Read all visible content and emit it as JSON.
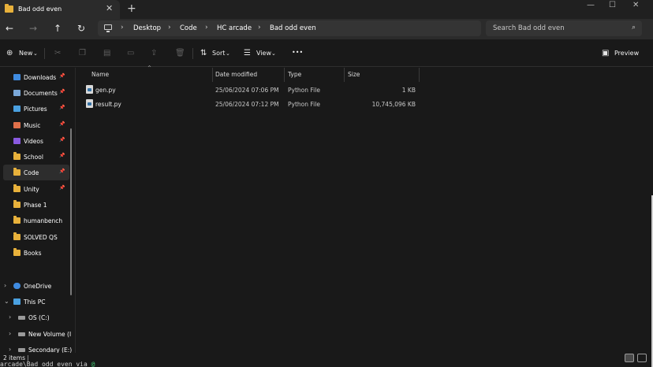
{
  "window": {
    "tab_title": "Bad odd even",
    "tab_close": "✕",
    "new_tab": "+",
    "minimize": "—",
    "maximize": "☐",
    "close": "✕"
  },
  "nav": {
    "back": "←",
    "forward": "→",
    "up": "↑",
    "refresh": "↻"
  },
  "breadcrumb": [
    "Desktop",
    "Code",
    "HC arcade",
    "Bad odd even"
  ],
  "search": {
    "placeholder": "Search Bad odd even"
  },
  "commands": {
    "new": "New",
    "sort": "Sort",
    "view": "View",
    "more": "•••",
    "preview": "Preview"
  },
  "sidebar": {
    "quick": [
      {
        "label": "Downloads",
        "icon": "download-icon",
        "color": "#3f8be0",
        "pinned": true
      },
      {
        "label": "Documents",
        "icon": "document-icon",
        "color": "#7aa7d8",
        "pinned": true
      },
      {
        "label": "Pictures",
        "icon": "picture-icon",
        "color": "#4aa0e0",
        "pinned": true
      },
      {
        "label": "Music",
        "icon": "music-icon",
        "color": "#e0704a",
        "pinned": true
      },
      {
        "label": "Videos",
        "icon": "video-icon",
        "color": "#8a5ae0",
        "pinned": true
      },
      {
        "label": "School",
        "icon": "folder-icon",
        "color": "#e8b13b",
        "pinned": true
      },
      {
        "label": "Code",
        "icon": "folder-icon",
        "color": "#e8b13b",
        "pinned": true,
        "active": true
      },
      {
        "label": "Unity",
        "icon": "folder-icon",
        "color": "#e8b13b",
        "pinned": true
      },
      {
        "label": "Phase 1",
        "icon": "folder-icon",
        "color": "#e8b13b",
        "pinned": false
      },
      {
        "label": "humanbench",
        "icon": "folder-icon",
        "color": "#e8b13b",
        "pinned": false
      },
      {
        "label": "SOLVED QS",
        "icon": "folder-icon",
        "color": "#e8b13b",
        "pinned": false
      },
      {
        "label": "Books",
        "icon": "folder-icon",
        "color": "#e8b13b",
        "pinned": false
      }
    ],
    "tree": [
      {
        "label": "OneDrive",
        "icon": "cloud-icon",
        "color": "#3f8be0",
        "chevron": "›"
      },
      {
        "label": "This PC",
        "icon": "pc-icon",
        "color": "#4aa0e0",
        "chevron": "⌄"
      },
      {
        "label": "OS (C:)",
        "icon": "drive-icon",
        "color": "#9a9a9a",
        "chevron": "›"
      },
      {
        "label": "New Volume (I",
        "icon": "drive-icon",
        "color": "#9a9a9a",
        "chevron": "›"
      },
      {
        "label": "Secondary (E:)",
        "icon": "drive-icon",
        "color": "#9a9a9a",
        "chevron": "›"
      }
    ]
  },
  "columns": {
    "name": "Name",
    "date": "Date modified",
    "type": "Type",
    "size": "Size"
  },
  "files": [
    {
      "name": "gen.py",
      "date": "25/06/2024 07:06 PM",
      "type": "Python File",
      "size": "1 KB"
    },
    {
      "name": "result.py",
      "date": "25/06/2024 07:12 PM",
      "type": "Python File",
      "size": "10,745,096 KB"
    }
  ],
  "status": {
    "count": "2 items",
    "terminal": "arcade\\Bad odd even via",
    "terminal_glyph": "@"
  }
}
